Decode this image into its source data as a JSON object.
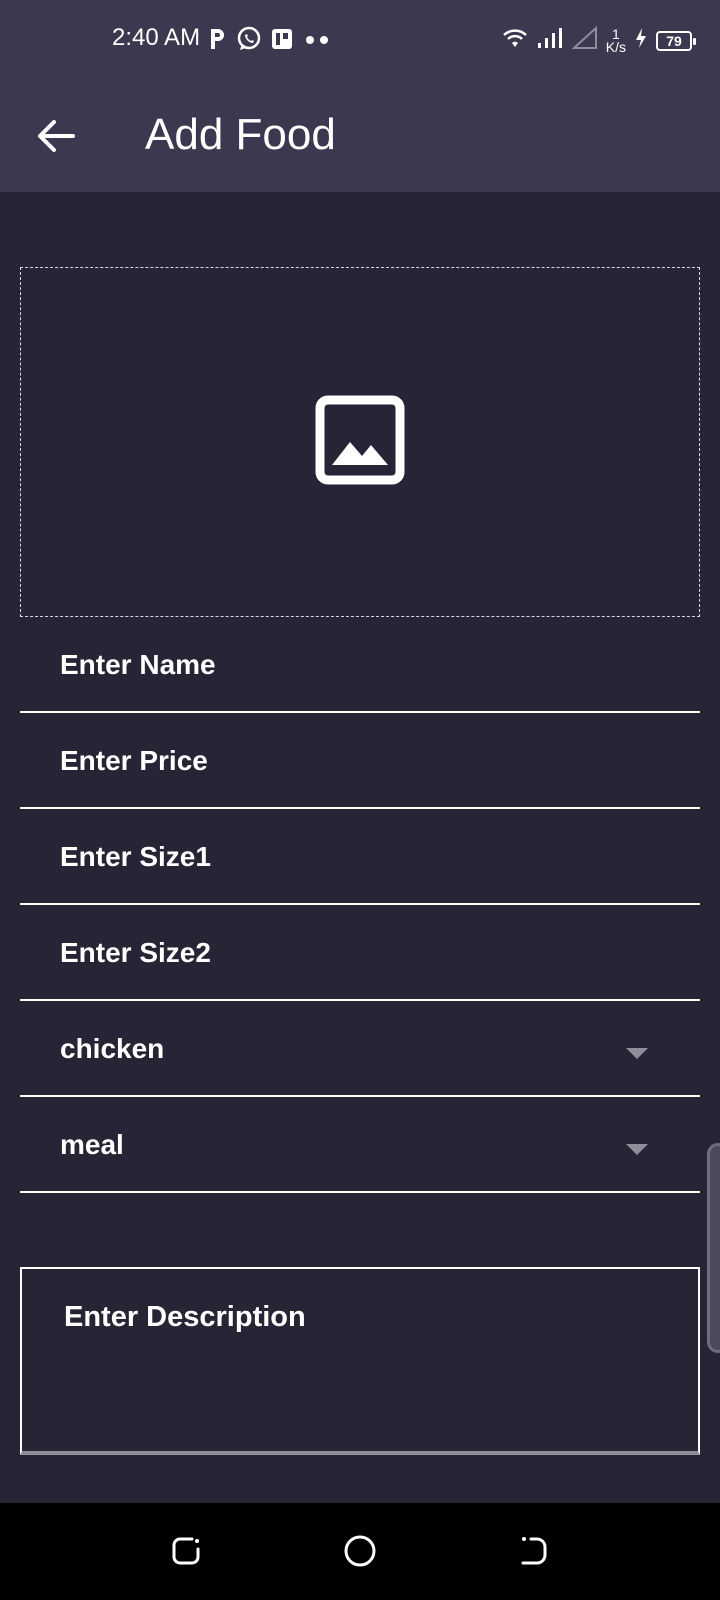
{
  "status_bar": {
    "time": "2:40 AM",
    "left_icons": [
      "parking-icon",
      "whatsapp-icon",
      "app-icon",
      "more-dots-icon"
    ],
    "network_speed_value": "1",
    "network_speed_unit": "K/s",
    "battery_level": "79",
    "right_icons": [
      "wifi-icon",
      "signal-icon",
      "signal-empty-icon",
      "charging-icon",
      "battery-icon"
    ]
  },
  "app_bar": {
    "title": "Add Food",
    "back_icon": "arrow-back-icon"
  },
  "image_picker": {
    "icon": "image-icon"
  },
  "form": {
    "name_placeholder": "Enter Name",
    "price_placeholder": "Enter Price",
    "size1_placeholder": "Enter Size1",
    "size2_placeholder": "Enter Size2",
    "category_value": "chicken",
    "type_value": "meal",
    "description_placeholder": "Enter Description"
  },
  "colors": {
    "background": "#262536",
    "app_bar": "#3a394f",
    "text": "#ffffff",
    "dropdown_arrow": "#8e8d9a"
  },
  "nav_bar": {
    "icons": [
      "recents-icon",
      "home-icon",
      "back-nav-icon"
    ]
  }
}
